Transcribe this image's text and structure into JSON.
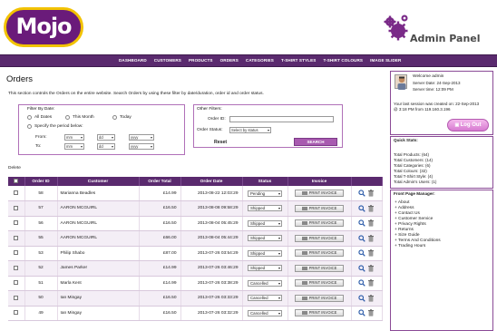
{
  "header": {
    "logo_text": "Mojo",
    "admin_panel_title": "Admin Panel"
  },
  "nav": {
    "items": [
      "DASHBOARD",
      "CUSTOMERS",
      "PRODUCTS",
      "ORDERS",
      "CATEGORIES",
      "T-SHIRT STYLES",
      "T-SHIRT COLOURS",
      "IMAGE SLIDER"
    ]
  },
  "main": {
    "title": "Orders",
    "intro": "This section controls the Orders on the entire website. Search Orders by using these filter by date/duration, order id and order status.",
    "filter_date": {
      "title": "Filter By Date:",
      "opt_all": "All Dates",
      "opt_month": "This Month",
      "opt_today": "Today",
      "opt_period": "Specify the period below:",
      "from_label": "From:",
      "to_label": "To:",
      "mm": "mm",
      "dd": "dd",
      "yyyy": "yyyy"
    },
    "filter_other": {
      "title": "Other Filters:",
      "order_id_label": "Order ID:",
      "order_status_label": "Order Status:",
      "status_placeholder": "Select by status",
      "reset_label": "Reset",
      "search_label": "SEARCH"
    },
    "delete_label": "Delete",
    "table": {
      "headers": [
        "",
        "Order ID",
        "Customer",
        "Order Total",
        "Order Date",
        "Status",
        "Invoice",
        ""
      ],
      "print_label": "PRINT INVOICE",
      "rows": [
        {
          "id": "58",
          "customer": "Marianna Beadles",
          "total": "£14.99",
          "date": "2013-08-22 12:03:29",
          "status": "Pending"
        },
        {
          "id": "57",
          "customer": "AARON MCGUIRL",
          "total": "£16.50",
          "date": "2013-08-08 09:58:29",
          "status": "Shipped"
        },
        {
          "id": "56",
          "customer": "AARON MCGUIRL",
          "total": "£16.50",
          "date": "2013-08-04 05:45:29",
          "status": "Shipped"
        },
        {
          "id": "55",
          "customer": "AARON MCGUIRL",
          "total": "£66.00",
          "date": "2013-08-04 05:44:29",
          "status": "Shipped"
        },
        {
          "id": "53",
          "customer": "Philip Shabo",
          "total": "£87.00",
          "date": "2013-07-26 03:54:29",
          "status": "Shipped"
        },
        {
          "id": "52",
          "customer": "James Parker",
          "total": "£14.99",
          "date": "2013-07-26 03:46:29",
          "status": "Shipped"
        },
        {
          "id": "51",
          "customer": "Marla Kent",
          "total": "£14.99",
          "date": "2013-07-26 03:38:29",
          "status": "Cancelled"
        },
        {
          "id": "50",
          "customer": "Ian Mingay",
          "total": "£16.50",
          "date": "2013-07-26 03:33:29",
          "status": "Cancelled"
        },
        {
          "id": "49",
          "customer": "Ian Mingay",
          "total": "£16.50",
          "date": "2013-07-26 03:32:29",
          "status": "Cancelled"
        }
      ]
    }
  },
  "sidebar": {
    "welcome": "Welcome admin",
    "server_date": "Server Date: 24-Sep-2013",
    "server_time": "Server time: 12:09 PM",
    "last_session_1": "Your last session was created on: 22-Sep-2013",
    "last_session_2": "@ 3:18 PM from 119.160.3.196",
    "logout_label": "Log Out",
    "stats_title": "Quick Stats:",
    "stats": [
      "Total Products: (64)",
      "Total Customers: (14)",
      "Total Categories: (6)",
      "Total Colours: (32)",
      "Total T-Shirt Style: (4)",
      "Total Admin's Users: (1)"
    ],
    "fpm_title": "Front Page Manager:",
    "fpm_links": [
      "+ About",
      "+ Address",
      "+ Contact Us",
      "+ Customer Service",
      "+ Privacy Rights",
      "+ Returns",
      "+ Size Guide",
      "+ Terms And Conditions",
      "+ Trading Hours"
    ]
  },
  "colors": {
    "brand_purple": "#5a2a6e",
    "accent_pink": "#a85ab0",
    "logo_yellow": "#f2c200"
  }
}
